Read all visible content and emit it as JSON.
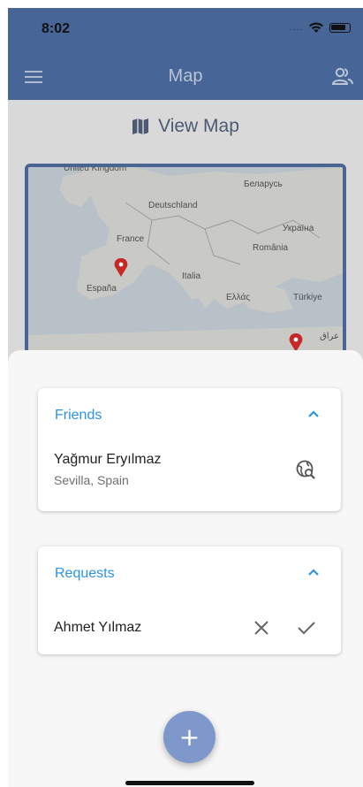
{
  "status_bar": {
    "time": "8:02",
    "signal": "....",
    "wifi_icon": "wifi-icon",
    "battery_icon": "battery-icon"
  },
  "app_bar": {
    "title": "Map",
    "menu_icon": "hamburger-menu-icon",
    "people_icon": "people-icon"
  },
  "page": {
    "view_map_label": "View Map",
    "view_map_icon": "map-icon",
    "map_labels": [
      "United Kingdom",
      "Беларусь",
      "Deutschland",
      "Україна",
      "France",
      "România",
      "Italia",
      "España",
      "Ελλάς",
      "Türkiye",
      "عراق"
    ]
  },
  "sheet": {
    "friends": {
      "title": "Friends",
      "items": [
        {
          "name": "Yağmur Eryılmaz",
          "location": "Sevilla, Spain",
          "action_icon": "globe-search-icon"
        }
      ]
    },
    "requests": {
      "title": "Requests",
      "items": [
        {
          "name": "Ahmet Yılmaz",
          "reject_icon": "close-icon",
          "accept_icon": "check-icon"
        }
      ]
    }
  },
  "fab": {
    "label": "+",
    "icon": "plus-icon"
  },
  "colors": {
    "app_bar": "#486597",
    "accent": "#2b94e3",
    "fab": "#7f98cc",
    "marker": "#c62828"
  }
}
